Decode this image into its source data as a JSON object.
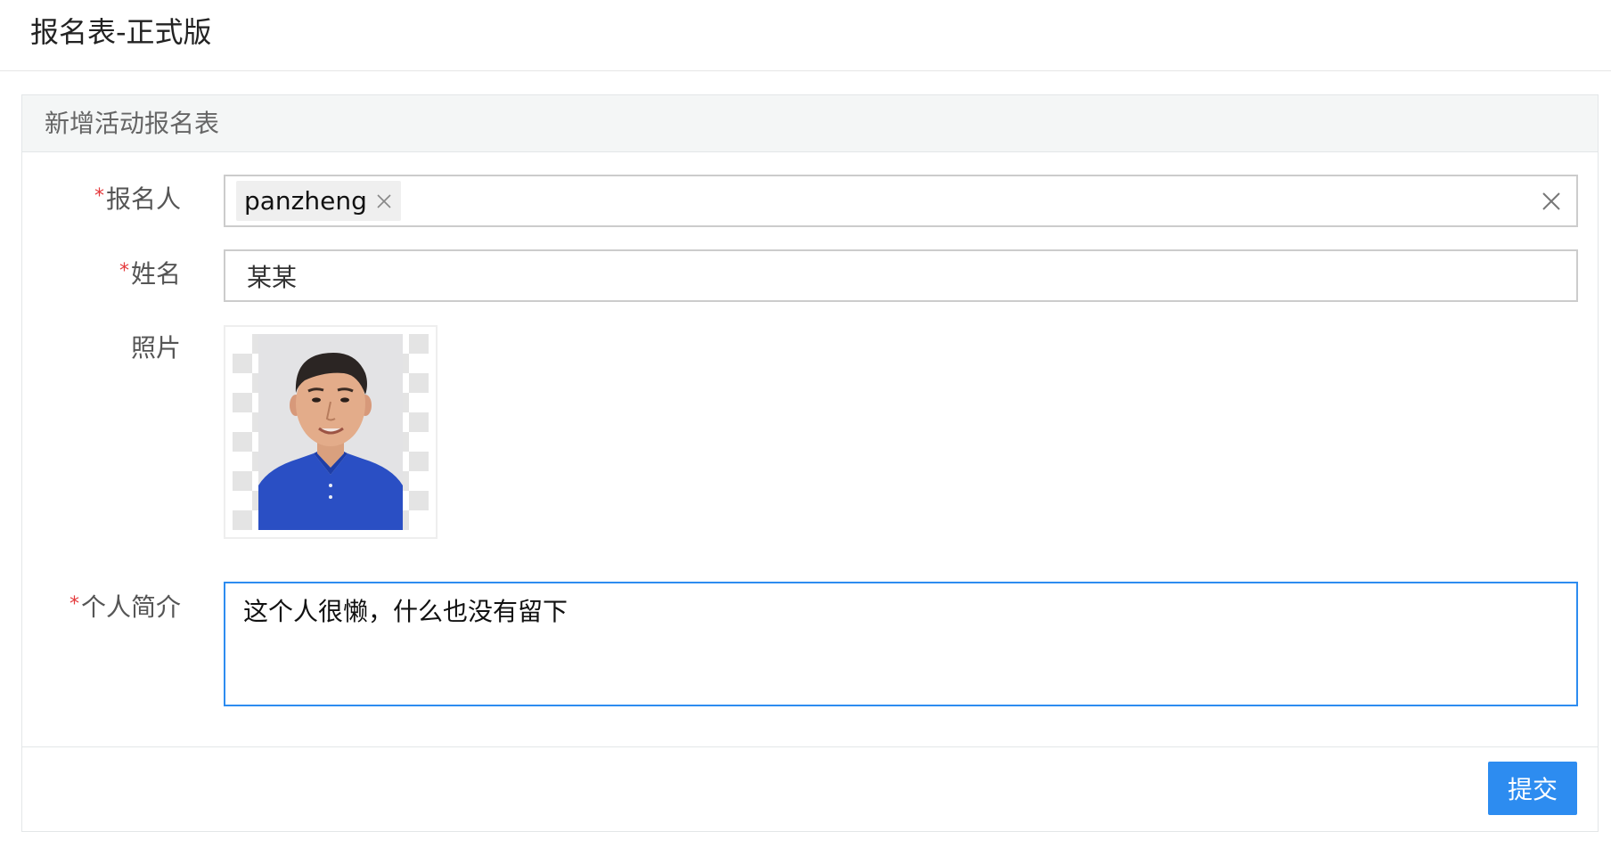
{
  "page": {
    "title": "报名表-正式版"
  },
  "panel": {
    "heading": "新增活动报名表"
  },
  "form": {
    "registrant": {
      "label": "报名人",
      "required_mark": "*",
      "tag": "panzheng",
      "tag_close_icon": "close-icon",
      "clear_icon": "close-icon"
    },
    "name": {
      "label": "姓名",
      "required_mark": "*",
      "value": "某某"
    },
    "photo": {
      "label": "照片",
      "icon": "person-photo"
    },
    "bio": {
      "label": "个人简介",
      "required_mark": "*",
      "value": "这个人很懒，什么也没有留下"
    }
  },
  "footer": {
    "submit_label": "提交"
  },
  "colors": {
    "primary": "#2d8cf0",
    "required": "#e4393c",
    "border": "#cccccc",
    "heading_bg": "#f4f6f6"
  }
}
